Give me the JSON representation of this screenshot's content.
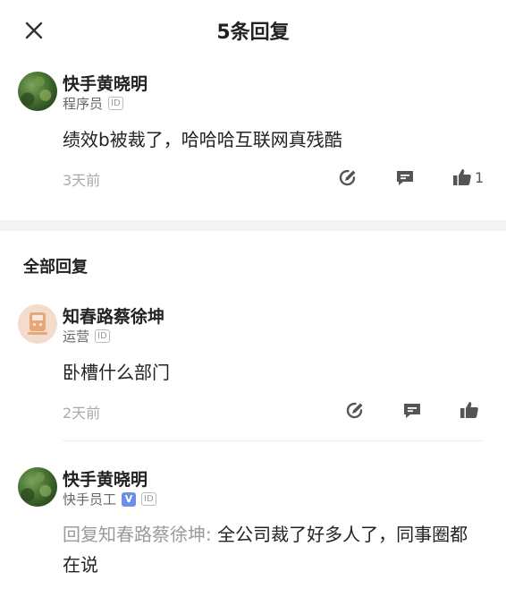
{
  "header": {
    "title": "5条回复",
    "close_icon": "close-icon"
  },
  "main_comment": {
    "username": "快手黄晓明",
    "role": "程序员",
    "id_badge": "ID",
    "text": "绩效b被裁了，哈哈哈互联网真残酷",
    "time": "3天前",
    "like_count": "1",
    "icons": [
      "edit-icon",
      "comment-icon",
      "like-icon"
    ]
  },
  "section": {
    "title": "全部回复"
  },
  "replies": [
    {
      "username": "知春路蔡徐坤",
      "role": "运营",
      "id_badge": "ID",
      "text": "卧槽什么部门",
      "time": "2天前",
      "icons": [
        "edit-icon",
        "comment-icon",
        "like-icon"
      ]
    },
    {
      "username": "快手黄晓明",
      "role": "快手员工",
      "verified_badge": "V",
      "id_badge": "ID",
      "reply_prefix": "回复知春路蔡徐坤:",
      "text": " 全公司裁了好多人了，同事圈都在说"
    }
  ],
  "colors": {
    "text_primary": "#222222",
    "text_secondary": "#666666",
    "text_muted": "#aaaaaa",
    "verified_blue": "#6d8ee6",
    "divider": "#f4f4f4"
  }
}
